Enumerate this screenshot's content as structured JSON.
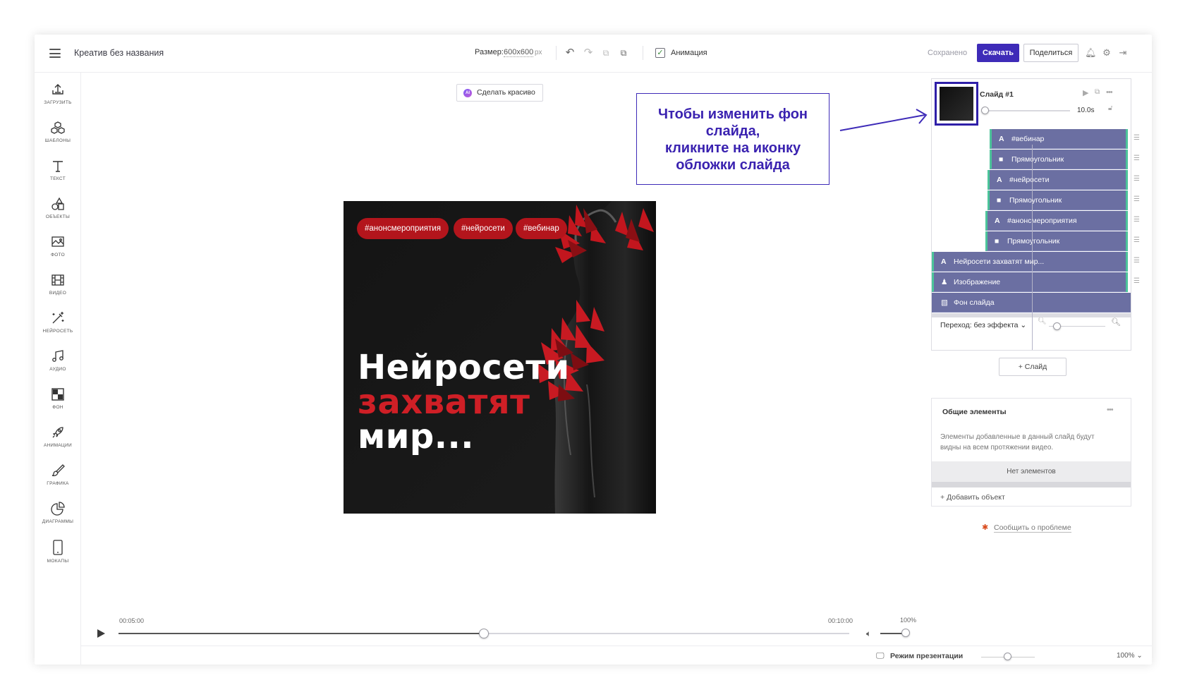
{
  "header": {
    "title": "Креатив без названия",
    "size_label": "Размер:",
    "size_value": "600x600",
    "size_unit": "px",
    "animation_label": "Анимация",
    "animation_checked": true,
    "saved_status": "Сохранено",
    "download_label": "Скачать",
    "share_label": "Поделиться"
  },
  "sidebar": {
    "items": [
      {
        "label": "Загрузить",
        "icon": "upload-icon"
      },
      {
        "label": "Шаблоны",
        "icon": "templates-icon"
      },
      {
        "label": "Текст",
        "icon": "text-icon"
      },
      {
        "label": "Объекты",
        "icon": "shapes-icon"
      },
      {
        "label": "Фото",
        "icon": "photo-icon"
      },
      {
        "label": "Видео",
        "icon": "video-icon"
      },
      {
        "label": "Нейросеть",
        "icon": "magic-wand-icon"
      },
      {
        "label": "Аудио",
        "icon": "music-icon"
      },
      {
        "label": "Фон",
        "icon": "background-icon"
      },
      {
        "label": "Анимации",
        "icon": "rocket-icon"
      },
      {
        "label": "Графика",
        "icon": "brush-icon"
      },
      {
        "label": "Диаграммы",
        "icon": "pie-chart-icon"
      },
      {
        "label": "Мокапы",
        "icon": "phone-icon"
      }
    ]
  },
  "canvas": {
    "beautify_button": "Сделать красиво",
    "ai_badge": "AI",
    "slide": {
      "tags": [
        "#анонсмероприятия",
        "#нейросети",
        "#вебинар"
      ],
      "headline_line1": "Нейросети",
      "headline_line2": "захватят",
      "headline_line3": "мир...",
      "accent_color": "#cf1f26"
    }
  },
  "callout": {
    "line1": "Чтобы изменить фон",
    "line2": "слайда,",
    "line3": "кликните на иконку",
    "line4": "обложки слайда"
  },
  "timeline": {
    "current_time": "00:05:00",
    "end_time": "00:10:00",
    "progress": 0.5,
    "volume_label": "100%",
    "volume": 1.0
  },
  "bottom": {
    "presentation_label": "Режим презентации",
    "zoom_value": "100%"
  },
  "slides_panel": {
    "slide_name": "Слайд #1",
    "duration": "10.0s",
    "layers": [
      {
        "icon": "A",
        "label": "#вебинар"
      },
      {
        "icon": "■",
        "label": "Прямоугольник"
      },
      {
        "icon": "A",
        "label": "#нейросети"
      },
      {
        "icon": "■",
        "label": "Прямоугольник"
      },
      {
        "icon": "A",
        "label": "#анонсмероприятия"
      },
      {
        "icon": "■",
        "label": "Прямоугольник"
      },
      {
        "icon": "A",
        "label": "Нейросети захватят мир..."
      },
      {
        "icon": "♟",
        "label": "Изображение"
      },
      {
        "icon": "▧",
        "label": "Фон слайда"
      }
    ],
    "transition_label": "Переход: без эффекта",
    "add_slide_label": "+ Слайд"
  },
  "common_elements": {
    "title": "Общие элементы",
    "description": "Элементы добавленные в данный слайд будут видны на всем протяжении видео.",
    "empty_label": "Нет элементов",
    "add_object_label": "Добавить объект"
  },
  "report_problem": "Сообщить о проблеме"
}
